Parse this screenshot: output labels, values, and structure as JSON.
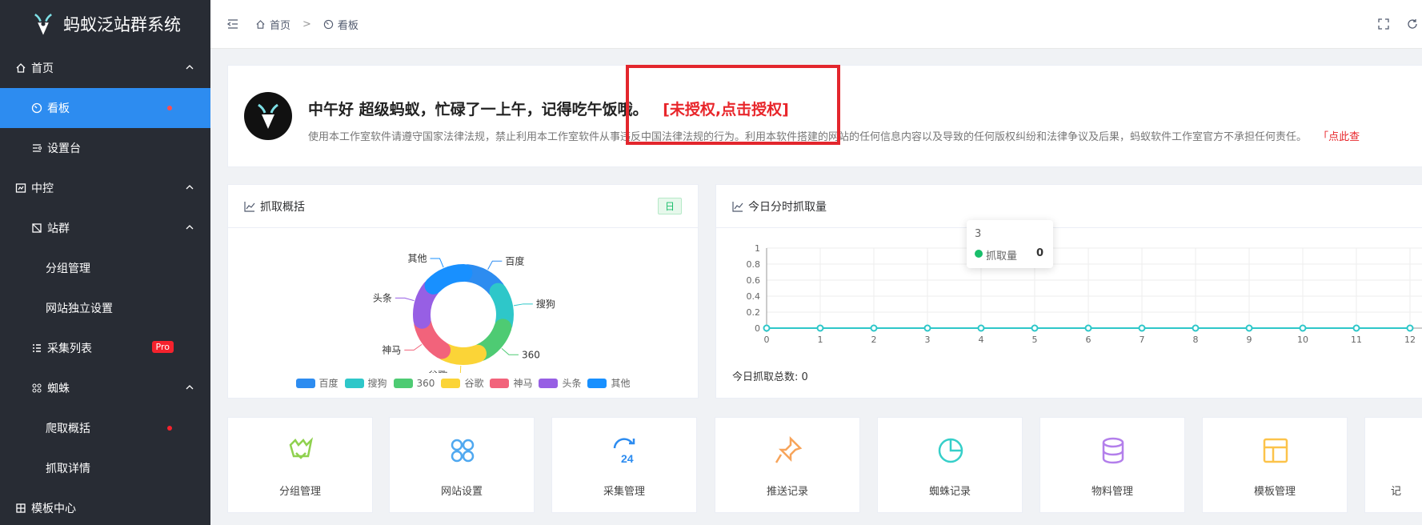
{
  "app": {
    "title": "蚂蚁泛站群系统"
  },
  "sidebar": {
    "items": [
      {
        "label": "首页",
        "icon": "home-icon",
        "level": 1,
        "expanded": true
      },
      {
        "label": "看板",
        "icon": "dashboard-icon",
        "level": 2,
        "active": true,
        "dot": true
      },
      {
        "label": "设置台",
        "icon": "settings-panel-icon",
        "level": 2
      },
      {
        "label": "中控",
        "icon": "control-icon",
        "level": 1,
        "expanded": true
      },
      {
        "label": "站群",
        "icon": "sites-icon",
        "level": 2,
        "expanded": true
      },
      {
        "label": "分组管理",
        "level": 3
      },
      {
        "label": "网站独立设置",
        "level": 3
      },
      {
        "label": "采集列表",
        "icon": "list-icon",
        "level": 2,
        "badge": "Pro"
      },
      {
        "label": "蜘蛛",
        "icon": "spider-icon",
        "level": 2,
        "expanded": true
      },
      {
        "label": "爬取概括",
        "level": 3,
        "dot": true
      },
      {
        "label": "抓取详情",
        "level": 3
      },
      {
        "label": "模板中心",
        "icon": "template-icon",
        "level": 1
      }
    ]
  },
  "header": {
    "breadcrumb": [
      {
        "label": "首页",
        "icon": "home-icon"
      },
      {
        "label": "看板",
        "icon": "dashboard-icon"
      }
    ],
    "separator": ">"
  },
  "welcome": {
    "greeting": "中午好 超级蚂蚁，忙碌了一上午，记得吃午饭哦。",
    "auth_link": "[未授权,点击授权]",
    "notice": "使用本工作室软件请遵守国家法律法规，禁止利用本工作室软件从事违反中国法律法规的行为。利用本软件搭建的网站的任何信息内容以及导致的任何版权纠纷和法律争议及后果，蚂蚁软件工作室官方不承担任何责任。",
    "notice_link": "「点此查"
  },
  "grab_card": {
    "title": "抓取概括",
    "tag": "日"
  },
  "today_card": {
    "title": "今日分时抓取量",
    "total_label": "今日抓取总数: 0",
    "tooltip": {
      "x": "3",
      "series": "抓取量",
      "value": "0"
    }
  },
  "chart_data": [
    {
      "type": "pie",
      "title": "抓取概括",
      "categories": [
        "百度",
        "搜狗",
        "360",
        "谷歌",
        "神马",
        "头条",
        "其他"
      ],
      "values": [
        1,
        1,
        1,
        1,
        1,
        1,
        1
      ],
      "colors": [
        "#2d8cf0",
        "#2ec7c9",
        "#4ecb73",
        "#fbd437",
        "#f2637b",
        "#975fe4",
        "#1890ff"
      ],
      "legend": "bottom"
    },
    {
      "type": "line",
      "title": "今日分时抓取量",
      "x": [
        0,
        1,
        2,
        3,
        4,
        5,
        6,
        7,
        8,
        9,
        10,
        11,
        12
      ],
      "series": [
        {
          "name": "抓取量",
          "values": [
            0,
            0,
            0,
            0,
            0,
            0,
            0,
            0,
            0,
            0,
            0,
            0,
            0
          ]
        }
      ],
      "yticks": [
        "0",
        "0.2",
        "0.4",
        "0.6",
        "0.8",
        "1"
      ],
      "ylim": [
        0,
        1
      ],
      "grid": true,
      "color": "#2ec7c9"
    }
  ],
  "quick_links": [
    {
      "label": "分组管理",
      "icon": "group-icon",
      "color": "#8fd14f"
    },
    {
      "label": "网站设置",
      "icon": "grid-icon",
      "color": "#4fa8f0"
    },
    {
      "label": "采集管理",
      "icon": "sync-24-icon",
      "color": "#2d8cf0"
    },
    {
      "label": "推送记录",
      "icon": "pin-icon",
      "color": "#f7a45a"
    },
    {
      "label": "蜘蛛记录",
      "icon": "pie-icon",
      "color": "#36cfc9"
    },
    {
      "label": "物料管理",
      "icon": "database-icon",
      "color": "#b37feb"
    },
    {
      "label": "模板管理",
      "icon": "layout-icon",
      "color": "#fcc34a"
    },
    {
      "label": "记",
      "icon": "more-icon",
      "color": "#999999"
    }
  ]
}
